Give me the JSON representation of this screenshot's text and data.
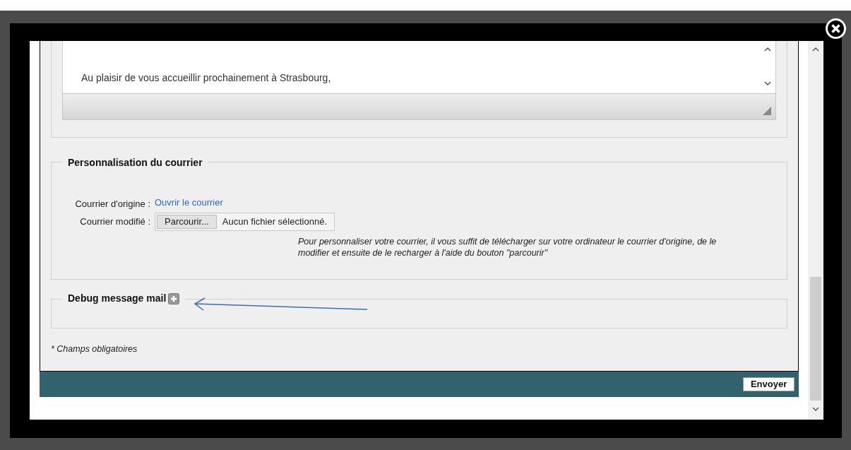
{
  "letter": {
    "text": "Au plaisir de vous accueillir prochainement à Strasbourg,"
  },
  "personalisation": {
    "legend": "Personnalisation du courrier",
    "fields": [
      {
        "kind": "link",
        "label": "Courrier d'origine :",
        "value": "Ouvrir le courrier"
      },
      {
        "kind": "file",
        "label": "Courrier modifié :",
        "button": "Parcourir...",
        "value": "Aucun fichier sélectionné."
      }
    ],
    "help": "Pour personnaliser votre courrier, il vous suffit de télécharger sur votre ordinateur le courrier d'origine, de le modifier et ensuite de le recharger à l'aide du bouton \"parcourir\""
  },
  "debug": {
    "legend": "Debug message mail",
    "expanded": false
  },
  "footnote": "* Champs obligatoires",
  "send_button": "Envoyer"
}
